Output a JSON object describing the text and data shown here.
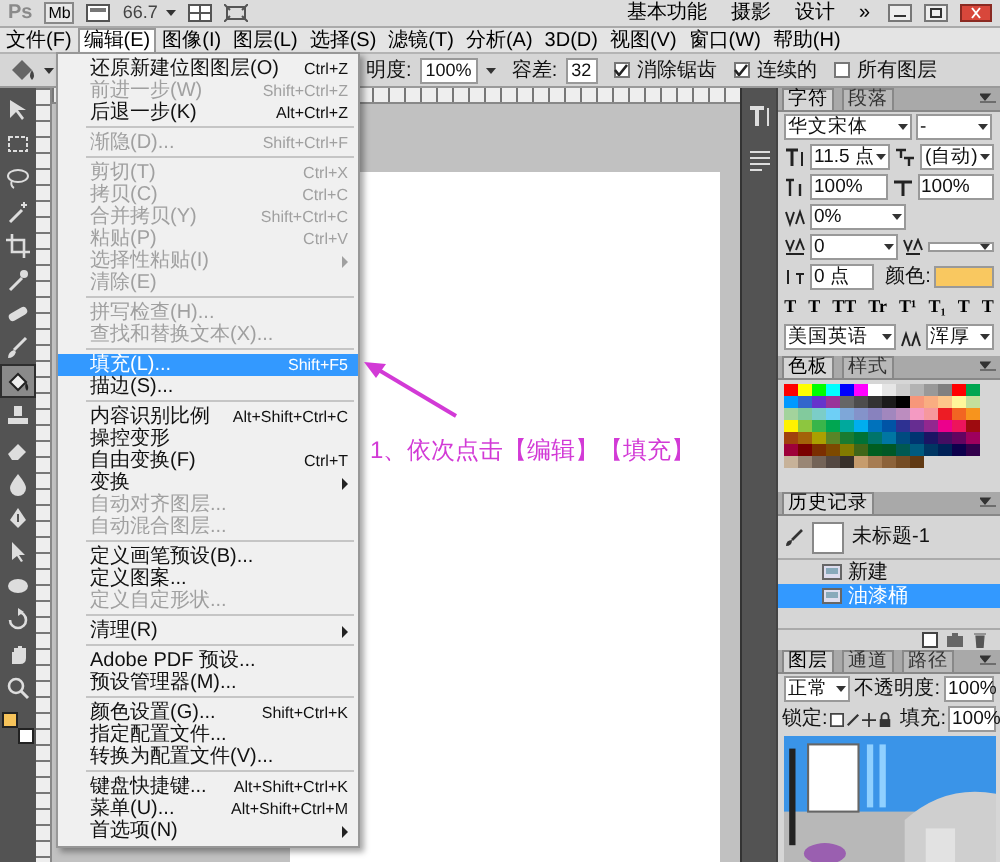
{
  "app_bar": {
    "logo": "Ps",
    "bridge": "Mb",
    "zoom": "66.7",
    "workspaces": [
      {
        "label": "基本功能",
        "selected": false
      },
      {
        "label": "摄影",
        "selected": false
      },
      {
        "label": "设计",
        "selected": false
      }
    ],
    "more": "»"
  },
  "menu_bar": [
    {
      "label": "文件(F)",
      "selected": false
    },
    {
      "label": "编辑(E)",
      "selected": true
    },
    {
      "label": "图像(I)",
      "selected": false
    },
    {
      "label": "图层(L)",
      "selected": false
    },
    {
      "label": "选择(S)",
      "selected": false
    },
    {
      "label": "滤镜(T)",
      "selected": false
    },
    {
      "label": "分析(A)",
      "selected": false
    },
    {
      "label": "3D(D)",
      "selected": false
    },
    {
      "label": "视图(V)",
      "selected": false
    },
    {
      "label": "窗口(W)",
      "selected": false
    },
    {
      "label": "帮助(H)",
      "selected": false
    }
  ],
  "options_bar": {
    "opacity_label": "明度:",
    "opacity": "100%",
    "tolerance_label": "容差:",
    "tolerance": "32",
    "checks": [
      {
        "label": "消除锯齿",
        "checked": true
      },
      {
        "label": "连续的",
        "checked": true
      },
      {
        "label": "所有图层",
        "checked": false
      }
    ]
  },
  "tools": [
    {
      "kind": "move",
      "selected": false
    },
    {
      "kind": "marquee",
      "selected": false
    },
    {
      "kind": "lasso",
      "selected": false
    },
    {
      "kind": "wand",
      "selected": false
    },
    {
      "kind": "crop",
      "selected": false
    },
    {
      "kind": "eyedropper",
      "selected": false
    },
    {
      "kind": "healing",
      "selected": false
    },
    {
      "kind": "brush",
      "selected": false
    },
    {
      "kind": "bucket",
      "selected": true
    },
    {
      "kind": "stamp",
      "selected": false
    },
    {
      "kind": "eraser",
      "selected": false
    },
    {
      "kind": "blur",
      "selected": false
    },
    {
      "kind": "pen",
      "selected": false
    },
    {
      "kind": "select",
      "selected": false
    },
    {
      "kind": "shape",
      "selected": false
    },
    {
      "kind": "rotate",
      "selected": false
    },
    {
      "kind": "hand",
      "selected": false
    },
    {
      "kind": "zoom",
      "selected": false
    }
  ],
  "color_chips": {
    "foreground": {
      "color": "#f6c35a"
    },
    "background": {
      "color": "#ffffff"
    }
  },
  "edit_menu": [
    {
      "kind": "item",
      "label": "还原新建位图图层(O)",
      "shortcut": "Ctrl+Z",
      "disabled": false,
      "selected": false
    },
    {
      "kind": "item",
      "label": "前进一步(W)",
      "shortcut": "Shift+Ctrl+Z",
      "disabled": true,
      "selected": false
    },
    {
      "kind": "item",
      "label": "后退一步(K)",
      "shortcut": "Alt+Ctrl+Z",
      "disabled": false,
      "selected": false
    },
    {
      "kind": "separator"
    },
    {
      "kind": "item",
      "label": "渐隐(D)...",
      "shortcut": "Shift+Ctrl+F",
      "disabled": true,
      "selected": false
    },
    {
      "kind": "separator"
    },
    {
      "kind": "item",
      "label": "剪切(T)",
      "shortcut": "Ctrl+X",
      "disabled": true,
      "selected": false
    },
    {
      "kind": "item",
      "label": "拷贝(C)",
      "shortcut": "Ctrl+C",
      "disabled": true,
      "selected": false
    },
    {
      "kind": "item",
      "label": "合并拷贝(Y)",
      "shortcut": "Shift+Ctrl+C",
      "disabled": true,
      "selected": false
    },
    {
      "kind": "item",
      "label": "粘贴(P)",
      "shortcut": "Ctrl+V",
      "disabled": true,
      "selected": false
    },
    {
      "kind": "submenu",
      "label": "选择性粘贴(I)",
      "disabled": true,
      "selected": false
    },
    {
      "kind": "item",
      "label": "清除(E)",
      "disabled": true,
      "selected": false
    },
    {
      "kind": "separator"
    },
    {
      "kind": "item",
      "label": "拼写检查(H)...",
      "disabled": true,
      "selected": false
    },
    {
      "kind": "item",
      "label": "查找和替换文本(X)...",
      "disabled": true,
      "selected": false
    },
    {
      "kind": "separator"
    },
    {
      "kind": "item",
      "label": "填充(L)...",
      "shortcut": "Shift+F5",
      "disabled": false,
      "selected": true
    },
    {
      "kind": "item",
      "label": "描边(S)...",
      "disabled": false,
      "selected": false
    },
    {
      "kind": "separator"
    },
    {
      "kind": "item",
      "label": "内容识别比例",
      "shortcut": "Alt+Shift+Ctrl+C",
      "disabled": false,
      "selected": false
    },
    {
      "kind": "item",
      "label": "操控变形",
      "disabled": false,
      "selected": false
    },
    {
      "kind": "item",
      "label": "自由变换(F)",
      "shortcut": "Ctrl+T",
      "disabled": false,
      "selected": false
    },
    {
      "kind": "submenu",
      "label": "变换",
      "disabled": false,
      "selected": false
    },
    {
      "kind": "item",
      "label": "自动对齐图层...",
      "disabled": true,
      "selected": false
    },
    {
      "kind": "item",
      "label": "自动混合图层...",
      "disabled": true,
      "selected": false
    },
    {
      "kind": "separator"
    },
    {
      "kind": "item",
      "label": "定义画笔预设(B)...",
      "disabled": false,
      "selected": false
    },
    {
      "kind": "item",
      "label": "定义图案...",
      "disabled": false,
      "selected": false
    },
    {
      "kind": "item",
      "label": "定义自定形状...",
      "disabled": true,
      "selected": false
    },
    {
      "kind": "separator"
    },
    {
      "kind": "submenu",
      "label": "清理(R)",
      "disabled": false,
      "selected": false
    },
    {
      "kind": "separator"
    },
    {
      "kind": "item",
      "label": "Adobe PDF 预设...",
      "disabled": false,
      "selected": false
    },
    {
      "kind": "item",
      "label": "预设管理器(M)...",
      "disabled": false,
      "selected": false
    },
    {
      "kind": "separator"
    },
    {
      "kind": "item",
      "label": "颜色设置(G)...",
      "shortcut": "Shift+Ctrl+K",
      "disabled": false,
      "selected": false
    },
    {
      "kind": "item",
      "label": "指定配置文件...",
      "disabled": false,
      "selected": false
    },
    {
      "kind": "item",
      "label": "转换为配置文件(V)...",
      "disabled": false,
      "selected": false
    },
    {
      "kind": "separator"
    },
    {
      "kind": "item",
      "label": "键盘快捷键...",
      "shortcut": "Alt+Shift+Ctrl+K",
      "disabled": false,
      "selected": false
    },
    {
      "kind": "item",
      "label": "菜单(U)...",
      "shortcut": "Alt+Shift+Ctrl+M",
      "disabled": false,
      "selected": false
    },
    {
      "kind": "submenu",
      "label": "首选项(N)",
      "disabled": false,
      "selected": false
    }
  ],
  "annotation": "1、依次点击【编辑】【填充】",
  "character_panel": {
    "tabs": [
      {
        "label": "字符",
        "selected": true
      },
      {
        "label": "段落",
        "selected": false
      }
    ],
    "font": "华文宋体",
    "style": "-",
    "size": "11.5 点",
    "leading": "(自动)",
    "vertical_scale": "100%",
    "horizontal_scale": "100%",
    "tsume": "0%",
    "kerning": "0",
    "baseline": "0 点",
    "color_label": "颜色:",
    "color": "#f9c860",
    "type_buttons": [
      "T",
      "T",
      "TT",
      "Tr",
      "T¹",
      "T₁",
      "T",
      "T"
    ],
    "language": "美国英语",
    "antialias": "浑厚"
  },
  "swatches_panel": {
    "tabs": [
      {
        "label": "色板",
        "selected": true
      },
      {
        "label": "样式",
        "selected": false
      }
    ],
    "swatches": [
      {
        "color": "#ff0000"
      },
      {
        "color": "#ffff00"
      },
      {
        "color": "#00ff00"
      },
      {
        "color": "#00ffff"
      },
      {
        "color": "#0000ff"
      },
      {
        "color": "#ff00ff"
      },
      {
        "color": "#ffffff"
      },
      {
        "color": "#e6e6e6"
      },
      {
        "color": "#cccccc"
      },
      {
        "color": "#b3b3b3"
      },
      {
        "color": "#999999"
      },
      {
        "color": "#808080"
      },
      {
        "color": "#ff0000"
      },
      {
        "color": "#00a651"
      },
      {
        "color": "#0099ff"
      },
      {
        "color": "#3366cc"
      },
      {
        "color": "#6633cc"
      },
      {
        "color": "#993399"
      },
      {
        "color": "#666666"
      },
      {
        "color": "#4d4d4d"
      },
      {
        "color": "#333333"
      },
      {
        "color": "#1a1a1a"
      },
      {
        "color": "#000000"
      },
      {
        "color": "#f7977a"
      },
      {
        "color": "#f9ad81"
      },
      {
        "color": "#fdc68a"
      },
      {
        "color": "#fff79a"
      },
      {
        "color": "#c4df9b"
      },
      {
        "color": "#a3d39c"
      },
      {
        "color": "#82ca9d"
      },
      {
        "color": "#7bcdc8"
      },
      {
        "color": "#6ecff6"
      },
      {
        "color": "#7ea7d8"
      },
      {
        "color": "#8493ca"
      },
      {
        "color": "#8882be"
      },
      {
        "color": "#a187be"
      },
      {
        "color": "#bc8dbf"
      },
      {
        "color": "#f49ac2"
      },
      {
        "color": "#f6989d"
      },
      {
        "color": "#ed1c24"
      },
      {
        "color": "#f26522"
      },
      {
        "color": "#f7941d"
      },
      {
        "color": "#fff200"
      },
      {
        "color": "#8dc63f"
      },
      {
        "color": "#39b54a"
      },
      {
        "color": "#00a651"
      },
      {
        "color": "#00a99d"
      },
      {
        "color": "#00aeef"
      },
      {
        "color": "#0072bc"
      },
      {
        "color": "#0054a6"
      },
      {
        "color": "#2e3192"
      },
      {
        "color": "#662d91"
      },
      {
        "color": "#92278f"
      },
      {
        "color": "#ec008c"
      },
      {
        "color": "#ed145b"
      },
      {
        "color": "#9e0b0f"
      },
      {
        "color": "#a0410d"
      },
      {
        "color": "#a36209"
      },
      {
        "color": "#aba000"
      },
      {
        "color": "#598527"
      },
      {
        "color": "#1a7b30"
      },
      {
        "color": "#007236"
      },
      {
        "color": "#00746b"
      },
      {
        "color": "#0076a3"
      },
      {
        "color": "#004b80"
      },
      {
        "color": "#003471"
      },
      {
        "color": "#1b1464"
      },
      {
        "color": "#440e62"
      },
      {
        "color": "#630460"
      },
      {
        "color": "#9e005d"
      },
      {
        "color": "#9e0039"
      },
      {
        "color": "#790000"
      },
      {
        "color": "#7b2e00"
      },
      {
        "color": "#7d4900"
      },
      {
        "color": "#827b00"
      },
      {
        "color": "#406618"
      },
      {
        "color": "#005e20"
      },
      {
        "color": "#005826"
      },
      {
        "color": "#005952"
      },
      {
        "color": "#005b7f"
      },
      {
        "color": "#003663"
      },
      {
        "color": "#002157"
      },
      {
        "color": "#0d004c"
      },
      {
        "color": "#32004b"
      },
      {
        "color": "#c7b299"
      },
      {
        "color": "#998675"
      },
      {
        "color": "#736357"
      },
      {
        "color": "#534741"
      },
      {
        "color": "#37302a"
      },
      {
        "color": "#c69c6d"
      },
      {
        "color": "#a67c52"
      },
      {
        "color": "#8c6239"
      },
      {
        "color": "#754c24"
      },
      {
        "color": "#603913"
      }
    ]
  },
  "history_panel": {
    "tabs": [
      {
        "label": "历史记录",
        "selected": true
      }
    ],
    "snapshot": "未标题-1",
    "states": [
      {
        "label": "新建",
        "selected": false
      },
      {
        "label": "油漆桶",
        "selected": true
      }
    ]
  },
  "layers_panel": {
    "tabs": [
      {
        "label": "图层",
        "selected": true
      },
      {
        "label": "通道",
        "selected": false
      },
      {
        "label": "路径",
        "selected": false
      }
    ],
    "blend_mode": "正常",
    "opacity_label": "不透明度:",
    "opacity": "100%",
    "lock_label": "锁定:",
    "fill_label": "填充:",
    "fill": "100%"
  }
}
